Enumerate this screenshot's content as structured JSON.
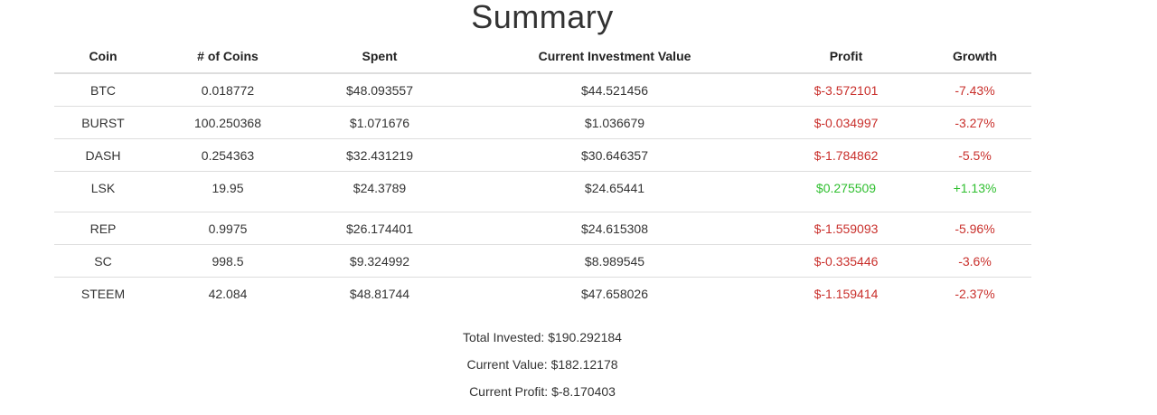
{
  "summary": {
    "title": "Summary",
    "columns": [
      "Coin",
      "# of Coins",
      "Spent",
      "Current Investment Value",
      "Profit",
      "Growth"
    ],
    "rows": [
      {
        "coin": "BTC",
        "coins": "0.018772",
        "spent": "$48.093557",
        "current": "$44.521456",
        "profit": "$-3.572101",
        "growth": "-7.43%"
      },
      {
        "coin": "BURST",
        "coins": "100.250368",
        "spent": "$1.071676",
        "current": "$1.036679",
        "profit": "$-0.034997",
        "growth": "-3.27%"
      },
      {
        "coin": "DASH",
        "coins": "0.254363",
        "spent": "$32.431219",
        "current": "$30.646357",
        "profit": "$-1.784862",
        "growth": "-5.5%"
      },
      {
        "coin": "LSK",
        "coins": "19.95",
        "spent": "$24.3789",
        "current": "$24.65441",
        "profit": "$0.275509",
        "growth": "+1.13%"
      },
      {
        "coin": "REP",
        "coins": "0.9975",
        "spent": "$26.174401",
        "current": "$24.615308",
        "profit": "$-1.559093",
        "growth": "-5.96%"
      },
      {
        "coin": "SC",
        "coins": "998.5",
        "spent": "$9.324992",
        "current": "$8.989545",
        "profit": "$-0.335446",
        "growth": "-3.6%"
      },
      {
        "coin": "STEEM",
        "coins": "42.084",
        "spent": "$48.81744",
        "current": "$47.658026",
        "profit": "$-1.159414",
        "growth": "-2.37%"
      }
    ]
  },
  "totals": {
    "total_invested": "Total Invested: $190.292184",
    "current_value": "Current Value: $182.12178",
    "current_profit": "Current Profit: $-8.170403"
  },
  "colors": {
    "negative": "#c9302c",
    "positive": "#2fbf2f"
  }
}
